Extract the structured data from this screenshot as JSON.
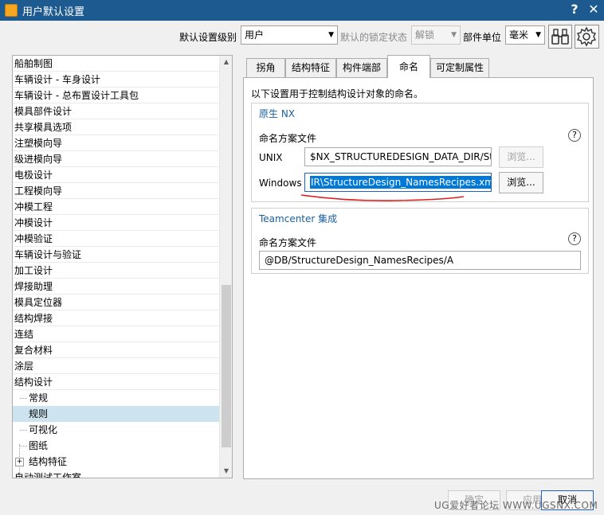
{
  "window": {
    "title": "用户默认设置",
    "help_glyph": "?",
    "close_glyph": "✕"
  },
  "toolbar": {
    "level_label": "默认设置级别",
    "level_value": "用户",
    "lock_label": "默认的锁定状态",
    "lock_value": "解锁",
    "unit_label": "部件单位",
    "unit_value": "毫米",
    "find_icon": "binoculars-icon",
    "settings_icon": "gear-icon"
  },
  "tree": {
    "items": [
      "船舶制图",
      "车辆设计 - 车身设计",
      "车辆设计 - 总布置设计工具包",
      "模具部件设计",
      "共享模具选项",
      "注塑模向导",
      "级进模向导",
      "电极设计",
      "工程模向导",
      "冲模工程",
      "冲模设计",
      "冲模验证",
      "车辆设计与验证",
      "加工设计",
      "焊接助理",
      "模具定位器",
      "结构焊接",
      "连结",
      "复合材料",
      "涂层",
      "结构设计"
    ],
    "children": [
      "常规",
      "规则",
      "可视化",
      "图纸",
      "结构特征"
    ],
    "partial_item": "自动测试工作室"
  },
  "tabs": [
    "拐角",
    "结构特征",
    "构件端部",
    "命名",
    "可定制属性"
  ],
  "panel": {
    "intro": "以下设置用于控制结构设计对象的命名。",
    "nx_group": {
      "title": "原生 NX",
      "subtitle": "命名方案文件",
      "unix_label": "UNIX",
      "unix_value": "$NX_STRUCTUREDESIGN_DATA_DIR/St",
      "windows_label": "Windows",
      "windows_value": "IR\\StructureDesign_NamesRecipes.xm",
      "browse_label": "浏览..."
    },
    "tc_group": {
      "title": "Teamcenter 集成",
      "subtitle": "命名方案文件",
      "value": "@DB/StructureDesign_NamesRecipes/A"
    }
  },
  "footer": {
    "ok": "确定",
    "apply": "应用",
    "cancel": "取消",
    "watermark": "UG爱好者论坛 WWW.UGSNX.COM"
  },
  "colors": {
    "titlebar": "#1c5a90",
    "accent": "#1a5fa0",
    "selection": "#cde3f0",
    "annotation": "#e02020"
  }
}
